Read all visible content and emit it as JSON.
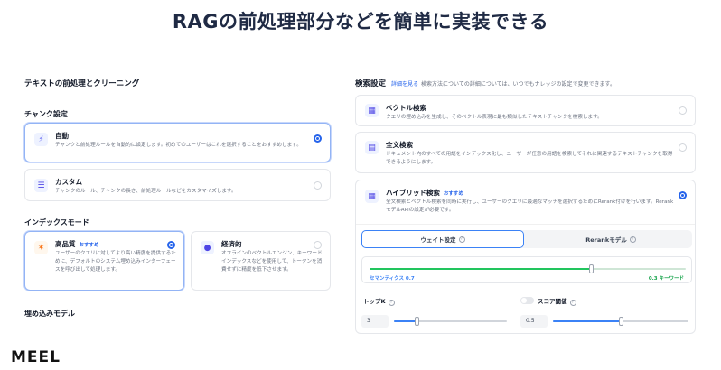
{
  "headline": "RAGの前処理部分などを簡単に実装できる",
  "left": {
    "title": "テキストの前処理とクリーニング",
    "chunk_label": "チャンク設定",
    "chunk_options": [
      {
        "title": "自動",
        "desc": "チャンクと前処理ルールを自動的に設定します。初めてのユーザーはこれを選択することをおすすめします。",
        "selected": true
      },
      {
        "title": "カスタム",
        "desc": "チャンクのルール、チャンクの長さ、前処理ルールなどをカスタマイズします。",
        "selected": false
      }
    ],
    "index_label": "インデックスモード",
    "index_options": [
      {
        "title": "高品質",
        "badge": "おすすめ",
        "desc": "ユーザーのクエリに対してより高い精度を提供するために、デフォルトのシステム埋め込みインターフェースを呼び出して処理します。",
        "selected": true
      },
      {
        "title": "経済的",
        "desc": "オフラインのベクトルエンジン、キーワードインデックスなどを使用して、トークンを消費せずに精度を低下させます。",
        "selected": false
      }
    ],
    "embed_label": "埋め込みモデル"
  },
  "right": {
    "title": "検索設定",
    "link": "詳細を見る",
    "hint": "検索方法についての詳細については、いつでもナレッジの設定で変更できます。",
    "options": [
      {
        "title": "ベクトル検索",
        "desc": "クエリの埋め込みを生成し、そのベクトル表現に最も類似したテキストチャンクを検索します。",
        "selected": false
      },
      {
        "title": "全文検索",
        "desc": "ドキュメント内のすべての用語をインデックス化し、ユーザーが任意の用語を検索してそれに関連するテキストチャンクを取得できるようにします。",
        "selected": false
      },
      {
        "title": "ハイブリッド検索",
        "badge": "おすすめ",
        "desc": "全文検索とベクトル検索を同時に実行し、ユーザーのクエリに最適なマッチを選択するためにRerank付けを行います。RerankモデルAPIの設定が必要です。",
        "selected": true
      }
    ],
    "tabs": [
      {
        "label": "ウェイト設定",
        "active": true
      },
      {
        "label": "Rerankモデル",
        "active": false
      }
    ],
    "weights": {
      "semantic_label": "セマンティクス 0.7",
      "keyword_label": "0.3 キーワード",
      "semantic": 0.7
    },
    "topk": {
      "label": "トップK",
      "value": "3",
      "fraction": 0.2
    },
    "score": {
      "label": "スコア閾値",
      "value": "0.5",
      "fraction": 0.5
    }
  },
  "logo": "MEEL",
  "colors": {
    "accent": "#2563eb",
    "track": "#22c55e"
  }
}
